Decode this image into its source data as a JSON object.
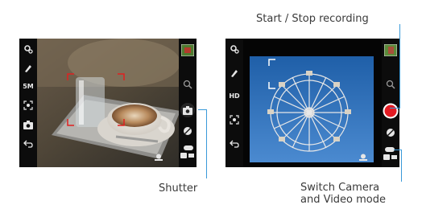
{
  "callouts": {
    "start_stop": "Start / Stop recording",
    "shutter": "Shutter",
    "switch_line1": "Switch Camera",
    "switch_line2": "and Video mode"
  },
  "photo_screen": {
    "resolution": "5M",
    "icons": [
      "settings-icon",
      "effects-icon",
      "resolution-label",
      "scene-icon",
      "camera-mode-icon",
      "back-icon",
      "thumbnail",
      "zoom-icon",
      "shutter-icon",
      "exposure-icon",
      "mode-switch-icon",
      "flash-icon"
    ]
  },
  "video_screen": {
    "resolution": "HD",
    "record_color": "#e31b23",
    "icons": [
      "settings-icon",
      "effects-icon",
      "resolution-label",
      "scene-icon",
      "back-icon",
      "thumbnail",
      "zoom-icon",
      "record-button",
      "exposure-icon",
      "mode-switch-icon",
      "flash-icon"
    ]
  },
  "colors": {
    "callout_line": "#3a9ad9",
    "focus_red": "#e02020",
    "focus_white": "#ffffff"
  }
}
